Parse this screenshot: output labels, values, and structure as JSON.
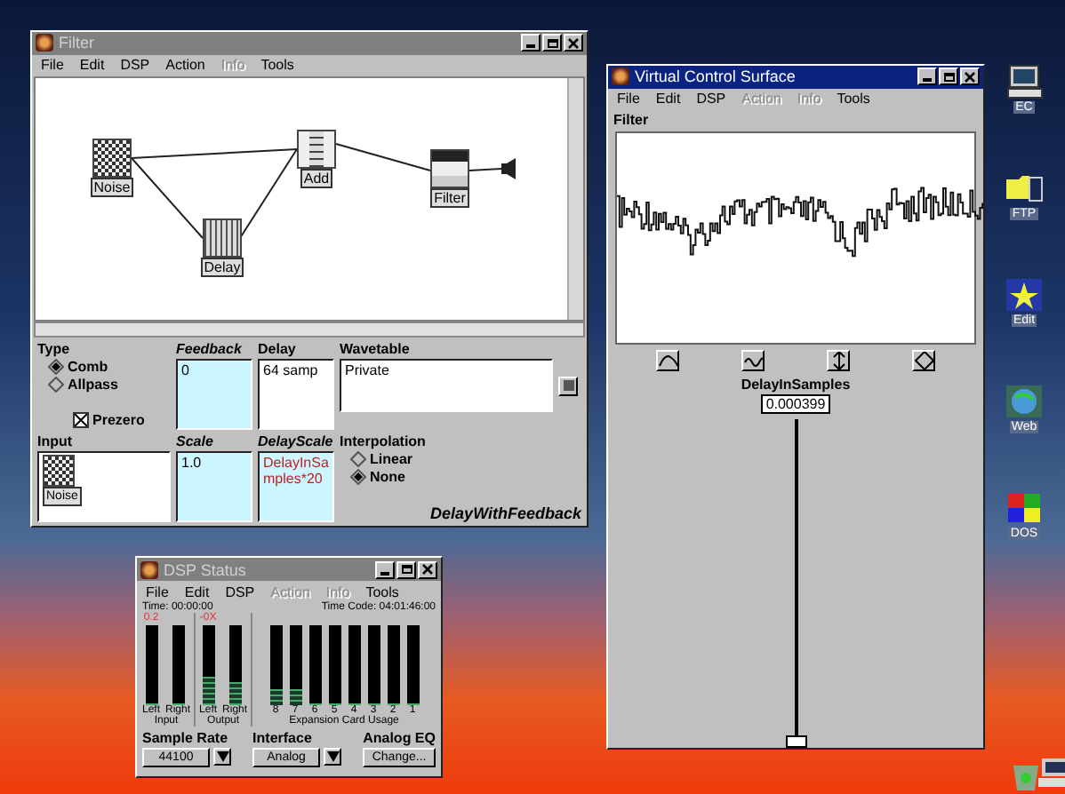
{
  "filter_window": {
    "title": "Filter",
    "menu": [
      {
        "label": "File",
        "disabled": false
      },
      {
        "label": "Edit",
        "disabled": false
      },
      {
        "label": "DSP",
        "disabled": false
      },
      {
        "label": "Action",
        "disabled": false
      },
      {
        "label": "Info",
        "disabled": true
      },
      {
        "label": "Tools",
        "disabled": false
      }
    ],
    "nodes": [
      {
        "label": "Noise",
        "kind": "noise"
      },
      {
        "label": "Delay",
        "kind": "delay"
      },
      {
        "label": "Add",
        "kind": "add"
      },
      {
        "label": "Filter",
        "kind": "filter"
      }
    ],
    "type": {
      "label": "Type",
      "options": [
        {
          "label": "Comb",
          "selected": true
        },
        {
          "label": "Allpass",
          "selected": false
        }
      ]
    },
    "prezero": {
      "label": "Prezero",
      "checked": true
    },
    "fields": [
      {
        "label": "Feedback",
        "value": "0",
        "kind": "cyan"
      },
      {
        "label": "Delay",
        "value": "64 samp",
        "kind": "plain"
      },
      {
        "label": "Wavetable",
        "value": "Private",
        "kind": "plain"
      }
    ],
    "input": {
      "label": "Input",
      "node": "Noise"
    },
    "fields_2": [
      {
        "label": "Scale",
        "value": "1.0",
        "kind": "cyan"
      },
      {
        "label": "DelayScale",
        "value": "DelayInSamples*20",
        "kind": "expr"
      }
    ],
    "interpolation": {
      "label": "Interpolation",
      "options": [
        {
          "label": "Linear",
          "selected": false
        },
        {
          "label": "None",
          "selected": true
        }
      ]
    },
    "footer": "DelayWithFeedback"
  },
  "vcs_window": {
    "title": "Virtual Control Surface",
    "menu": [
      {
        "label": "File",
        "disabled": false
      },
      {
        "label": "Edit",
        "disabled": false
      },
      {
        "label": "DSP",
        "disabled": false
      },
      {
        "label": "Action",
        "disabled": true
      },
      {
        "label": "Info",
        "disabled": true
      },
      {
        "label": "Tools",
        "disabled": false
      }
    ],
    "plot_label": "Filter",
    "parameter": "DelayInSamples",
    "value": "0.000399",
    "slider": {
      "level": 0
    }
  },
  "dsp_window": {
    "title": "DSP Status",
    "menu": [
      {
        "label": "File",
        "disabled": false
      },
      {
        "label": "Edit",
        "disabled": false
      },
      {
        "label": "DSP",
        "disabled": false
      },
      {
        "label": "Action",
        "disabled": true
      },
      {
        "label": "Info",
        "disabled": true
      },
      {
        "label": "Tools",
        "disabled": false
      }
    ],
    "time": "Time: 00:00:00",
    "time_code": "Time Code: 04:01:46:00",
    "groups": [
      {
        "label": "Input",
        "peak": "0.2",
        "meters": [
          {
            "label": "Left",
            "level": 0
          },
          {
            "label": "Right",
            "level": 0
          }
        ]
      },
      {
        "label": "Output",
        "peak": "-0X",
        "meters": [
          {
            "label": "Left",
            "level": 0.35
          },
          {
            "label": "Right",
            "level": 0.3
          }
        ]
      },
      {
        "label": "Expansion Card Usage",
        "meters": [
          {
            "label": "8",
            "level": 0.2
          },
          {
            "label": "7",
            "level": 0.2
          },
          {
            "label": "6",
            "level": 0
          },
          {
            "label": "5",
            "level": 0
          },
          {
            "label": "4",
            "level": 0
          },
          {
            "label": "3",
            "level": 0
          },
          {
            "label": "2",
            "level": 0
          },
          {
            "label": "1",
            "level": 0
          }
        ]
      }
    ],
    "sample_rate": {
      "label": "Sample Rate",
      "value": "44100"
    },
    "interface": {
      "label": "Interface",
      "value": "Analog"
    },
    "analog_eq": {
      "label": "Analog EQ",
      "button": "Change..."
    }
  },
  "desktop_icons": [
    {
      "label": "EC",
      "kind": "monitor"
    },
    {
      "label": "FTP",
      "kind": "folder"
    },
    {
      "label": "Edit",
      "kind": "star"
    },
    {
      "label": "Web",
      "kind": "globe"
    },
    {
      "label": "DOS",
      "kind": "msdos"
    }
  ]
}
